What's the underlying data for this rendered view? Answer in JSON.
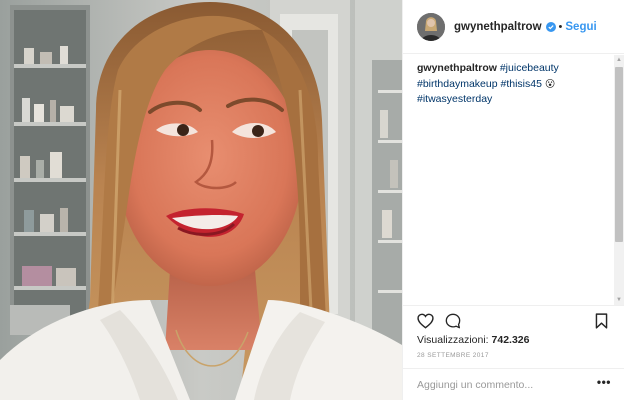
{
  "post": {
    "username": "gwynethpaltrow",
    "verified_icon": "verified-badge-icon",
    "separator": "•",
    "follow_label": "Segui",
    "caption": {
      "username": "gwynethpaltrow",
      "hashtags": [
        "#juicebeauty",
        "#birthdaymakeup",
        "#thisis45",
        "#itwasyesterday"
      ],
      "emoji": "😮"
    },
    "views_label": "Visualizzazioni:",
    "views_count": "742.326",
    "date": "28 SETTEMBRE 2017",
    "comment_placeholder": "Aggiungi un commento...",
    "more_label": "•••"
  },
  "icons": {
    "like": "heart-icon",
    "comment": "comment-icon",
    "save": "bookmark-icon",
    "scroll_up": "▲",
    "scroll_down": "▼"
  },
  "colors": {
    "link": "#003569",
    "follow": "#3897f0",
    "verified": "#3897f0",
    "muted": "#999999",
    "border": "#efefef"
  }
}
